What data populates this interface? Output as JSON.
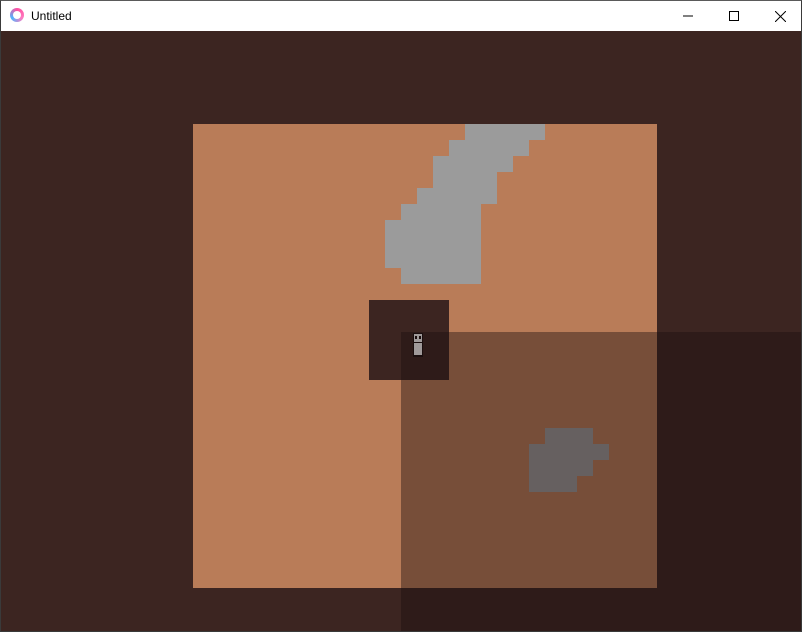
{
  "window": {
    "title": "Untitled",
    "icon": "app-heart-icon",
    "controls": [
      "minimize-icon",
      "maximize-icon",
      "close-icon"
    ]
  },
  "scene": {
    "colors": {
      "background": "#3c2521",
      "floor": "#b97c58",
      "rock": "#9b9b9b",
      "player_tile": "#3c2521",
      "shadow": "#1c0e0e"
    },
    "entities": [
      "floor",
      "rock-cluster-north",
      "rock-cluster-south",
      "player",
      "shadow-overlay"
    ]
  }
}
